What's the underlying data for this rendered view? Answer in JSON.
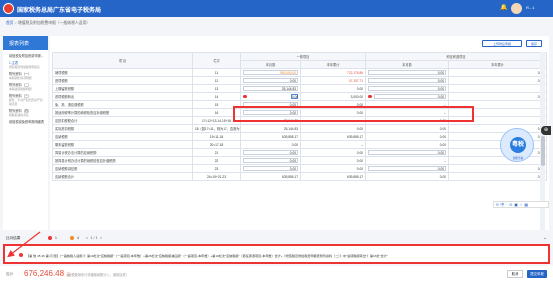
{
  "header": {
    "title": "国家税务总局广东省电子税务局",
    "user": "R...1"
  },
  "breadcrumb": {
    "home": "首页",
    "sep": ">",
    "current": "增值税及附加税费申报（一般纳税人适用）"
  },
  "sidebar": {
    "title": "报表列表",
    "items": [
      {
        "label": "增值税及附加税费申报...",
        "sub": ""
      },
      {
        "label": "1.主表",
        "sub": "增值税及附加税费申报表"
      },
      {
        "label": "附列资料（一）",
        "sub": "本期销售情况明细"
      },
      {
        "label": "附列资料（二）",
        "sub": "本期进项税额明细"
      },
      {
        "label": "附列资料（三）",
        "sub": "服务、不动产和无形资产扣除项目"
      },
      {
        "label": "附列资料（四）",
        "sub": "税额抵减情况表"
      },
      {
        "label": "增值税减免税申报明细表",
        "sub": ""
      }
    ]
  },
  "toolbar": {
    "btn1": "上传附征申报",
    "btn2": "保存"
  },
  "table": {
    "headers": {
      "item": "项  目",
      "row": "栏次",
      "general": "一般项目",
      "refund": "即征即退项目",
      "month": "本月数",
      "year": "本年累计"
    },
    "rows": [
      {
        "name": "销项税额",
        "row": "11",
        "v1": "950,000.00",
        "v2": "722,178.86",
        "v3": "0.00",
        "v4": "0.00",
        "c1": "org",
        "c2": "red"
      },
      {
        "name": "进项税额",
        "row": "12",
        "v1": "0.00",
        "v2": "47,157.71",
        "v3": "0.00",
        "v4": "0.00",
        "c2": "red"
      },
      {
        "name": "上期留抵税额",
        "row": "13",
        "v1": "25,144.83",
        "v2": "0.00",
        "v3": "0.00",
        "v4": "--"
      },
      {
        "name": "进项税额转出",
        "row": "14",
        "v1": "0.00",
        "v2": "3,000.00",
        "v3": "0.00",
        "v4": "0.00",
        "hl": true
      },
      {
        "name": "免、抵、退应退税额",
        "row": "15",
        "v1": "0.00",
        "v2": "0.00",
        "v3": "--",
        "v4": "--"
      },
      {
        "name": "按适用税率计算的纳税检查应补缴税额",
        "row": "16",
        "v1": "0.00",
        "v2": "0.00",
        "v3": "--",
        "v4": "--"
      },
      {
        "name": "应抵扣税额合计",
        "row": "17=12+13-14-15+16",
        "v1": "25,144.83",
        "v2": "--",
        "v3": "0.00",
        "v4": "--"
      },
      {
        "name": "实际抵扣税额",
        "row": "18（如17<11，则为17，否则为11）",
        "v1": "25,144.83",
        "v2": "0.00",
        "v3": "0.00",
        "v4": "0.00"
      },
      {
        "name": "应纳税额",
        "row": "19=11-18",
        "v1": "639,855.17",
        "v2": "639,855.17",
        "v3": "0.00",
        "v4": "0.00"
      },
      {
        "name": "期末留抵税额",
        "row": "20=17-18",
        "v1": "0.00",
        "v2": "--",
        "v3": "0.00",
        "v4": "--"
      },
      {
        "name": "简易计税办法计算的应纳税额",
        "row": "21",
        "v1": "0.00",
        "v2": "0.00",
        "v3": "0.00",
        "v4": "0.00"
      },
      {
        "name": "按简易计税办法计算的纳税检查应补缴税额",
        "row": "22",
        "v1": "0.00",
        "v2": "0.00",
        "v3": "--",
        "v4": "--"
      },
      {
        "name": "应纳税额减征额",
        "row": "23",
        "v1": "0.00",
        "v2": "0.00",
        "v3": "0.00",
        "v4": "0.00"
      },
      {
        "name": "应纳税额合计",
        "row": "24=19+21-23",
        "v1": "639,855.17",
        "v2": "639,855.17",
        "v3": "0.00",
        "v4": "0.00"
      }
    ]
  },
  "mascot": {
    "text": "粤税",
    "label": "智能咨询"
  },
  "zoom_label": "⊕",
  "tools": "S 中 · ⊙ ▣ ♂ ▦",
  "pager": {
    "label": "比对结果",
    "red_count": "1",
    "orange_count": "4",
    "page": "1 / 1",
    "prev": "<",
    "next": ">"
  },
  "error": {
    "index": "1.",
    "message": "【第 他 45 46 第 问 题】(一般纳税人适用）》第19栏次\"应纳税额\"（一般项目-本年数）+第26栏次\"应纳税额减征额\"（一般项目-本年数）+第19栏次\"应纳税额\"（即征即退项目-本年数）合计+《增值税及附加税费申报表附列资料（二）》中\"进项税额转出\"》第13栏\"合计\""
  },
  "footer": {
    "label": "应计",
    "amount": "676,246.48",
    "unit": "元",
    "note": "（纳税缴用系行非缓缴纳额计入，缴除加重）",
    "btn_back": "取消",
    "btn_submit": "提交申报"
  }
}
